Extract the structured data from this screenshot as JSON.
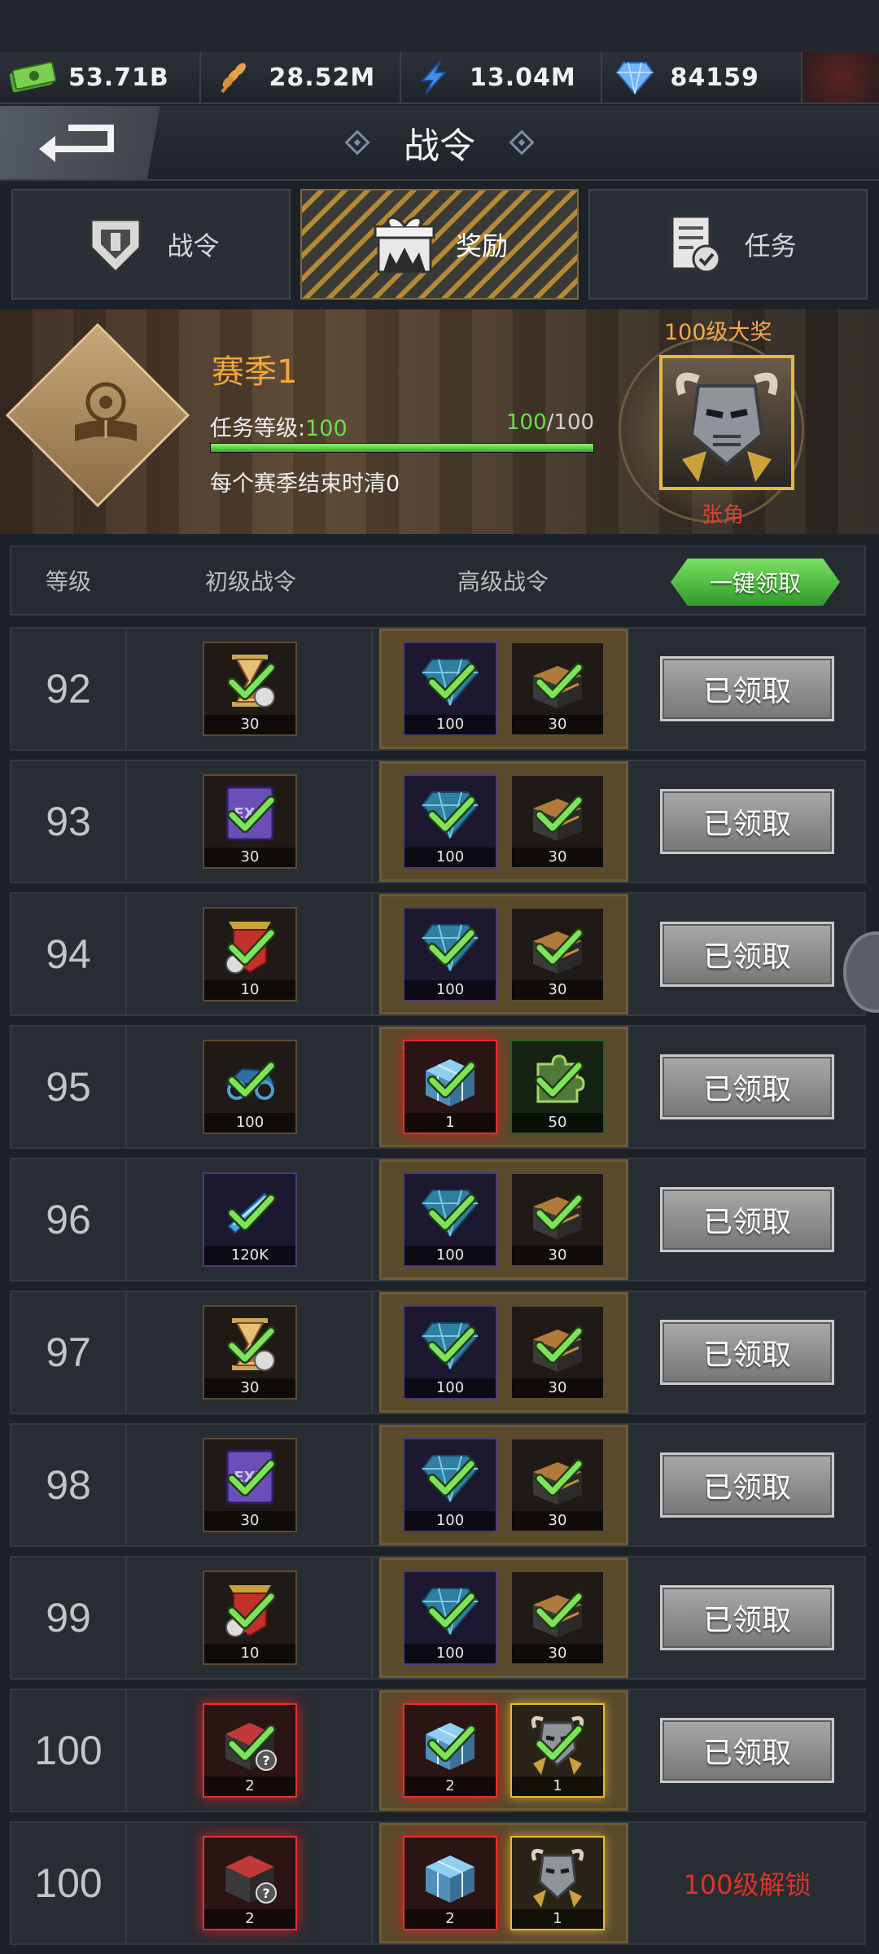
{
  "resources": [
    {
      "icon": "cash-icon",
      "value": "53.71B"
    },
    {
      "icon": "wheat-icon",
      "value": "28.52M"
    },
    {
      "icon": "lightning-icon",
      "value": "13.04M"
    },
    {
      "icon": "diamond-icon",
      "value": "84159"
    }
  ],
  "header": {
    "title": "战令",
    "back_icon": "back-arrow-icon"
  },
  "tabs": [
    {
      "label": "战令",
      "icon": "battle-pass-emblem-icon",
      "active": false
    },
    {
      "label": "奖励",
      "icon": "gift-box-icon",
      "active": true
    },
    {
      "label": "任务",
      "icon": "task-clipboard-icon",
      "active": false
    }
  ],
  "season": {
    "title": "赛季1",
    "task_level_label": "任务等级:",
    "task_level_value": "100",
    "progress_current": "100",
    "progress_sep": "/",
    "progress_max": "100",
    "progress_fraction": 1.0,
    "reset_note": "每个赛季结束时清0",
    "grand_prize_label": "100级大奖",
    "grand_prize_name": "张角"
  },
  "table": {
    "col_level": "等级",
    "col_basic": "初级战令",
    "col_premium": "高级战令",
    "claim_all": "一键领取"
  },
  "rows": [
    {
      "level": "92",
      "basic": {
        "icon": "hourglass-icon",
        "qty": "30",
        "frame": "brown",
        "claimed": true
      },
      "premium": [
        {
          "icon": "diamond-icon",
          "qty": "100",
          "frame": "purple",
          "claimed": true
        },
        {
          "icon": "treasure-chest-icon",
          "qty": "30",
          "frame": "brown",
          "claimed": true
        }
      ],
      "action": "已领取",
      "status": "claimed"
    },
    {
      "level": "93",
      "basic": {
        "icon": "exp-book-icon",
        "qty": "30",
        "frame": "brown",
        "claimed": true
      },
      "premium": [
        {
          "icon": "diamond-icon",
          "qty": "100",
          "frame": "purple",
          "claimed": true
        },
        {
          "icon": "treasure-chest-icon",
          "qty": "30",
          "frame": "brown",
          "claimed": true
        }
      ],
      "action": "已领取",
      "status": "claimed"
    },
    {
      "level": "94",
      "basic": {
        "icon": "banner-speedup-icon",
        "qty": "10",
        "frame": "brown",
        "claimed": true
      },
      "premium": [
        {
          "icon": "diamond-icon",
          "qty": "100",
          "frame": "purple",
          "claimed": true
        },
        {
          "icon": "treasure-chest-icon",
          "qty": "30",
          "frame": "brown",
          "claimed": true
        }
      ],
      "action": "已领取",
      "status": "claimed"
    },
    {
      "level": "95",
      "basic": {
        "icon": "chariot-icon",
        "qty": "100",
        "frame": "brown",
        "claimed": true
      },
      "premium": [
        {
          "icon": "cube-chest-icon",
          "qty": "1",
          "frame": "red",
          "claimed": true
        },
        {
          "icon": "puzzle-piece-icon",
          "qty": "50",
          "frame": "green",
          "claimed": true
        }
      ],
      "action": "已领取",
      "status": "claimed"
    },
    {
      "level": "96",
      "basic": {
        "icon": "energy-bolt-icon",
        "qty": "120K",
        "frame": "purple",
        "claimed": true
      },
      "premium": [
        {
          "icon": "diamond-icon",
          "qty": "100",
          "frame": "purple",
          "claimed": true
        },
        {
          "icon": "treasure-chest-icon",
          "qty": "30",
          "frame": "brown",
          "claimed": true
        }
      ],
      "action": "已领取",
      "status": "claimed"
    },
    {
      "level": "97",
      "basic": {
        "icon": "hourglass-icon",
        "qty": "30",
        "frame": "brown",
        "claimed": true
      },
      "premium": [
        {
          "icon": "diamond-icon",
          "qty": "100",
          "frame": "purple",
          "claimed": true
        },
        {
          "icon": "treasure-chest-icon",
          "qty": "30",
          "frame": "brown",
          "claimed": true
        }
      ],
      "action": "已领取",
      "status": "claimed"
    },
    {
      "level": "98",
      "basic": {
        "icon": "exp-book-icon",
        "qty": "30",
        "frame": "brown",
        "claimed": true
      },
      "premium": [
        {
          "icon": "diamond-icon",
          "qty": "100",
          "frame": "purple",
          "claimed": true
        },
        {
          "icon": "treasure-chest-icon",
          "qty": "30",
          "frame": "brown",
          "claimed": true
        }
      ],
      "action": "已领取",
      "status": "claimed"
    },
    {
      "level": "99",
      "basic": {
        "icon": "banner-speedup-icon",
        "qty": "10",
        "frame": "brown",
        "claimed": true
      },
      "premium": [
        {
          "icon": "diamond-icon",
          "qty": "100",
          "frame": "purple",
          "claimed": true
        },
        {
          "icon": "treasure-chest-icon",
          "qty": "30",
          "frame": "brown",
          "claimed": true
        }
      ],
      "action": "已领取",
      "status": "claimed"
    },
    {
      "level": "100",
      "basic": {
        "icon": "mystery-chest-icon",
        "qty": "2",
        "frame": "red",
        "claimed": true
      },
      "premium": [
        {
          "icon": "cube-chest-icon",
          "qty": "2",
          "frame": "red",
          "claimed": true
        },
        {
          "icon": "hero-portrait-icon",
          "qty": "1",
          "frame": "gold",
          "claimed": true
        }
      ],
      "action": "已领取",
      "status": "claimed"
    },
    {
      "level": "100",
      "basic": {
        "icon": "mystery-chest-icon",
        "qty": "2",
        "frame": "red",
        "claimed": false
      },
      "premium": [
        {
          "icon": "cube-chest-icon",
          "qty": "2",
          "frame": "red",
          "claimed": false
        },
        {
          "icon": "hero-portrait-icon",
          "qty": "1",
          "frame": "gold",
          "claimed": false
        }
      ],
      "action": "100级解锁",
      "status": "locked"
    }
  ],
  "colors": {
    "accent_green": "#6ddc4f",
    "accent_orange": "#f4a63a",
    "locked_red": "#d8352a",
    "gold_frame": "#e6b93a"
  }
}
